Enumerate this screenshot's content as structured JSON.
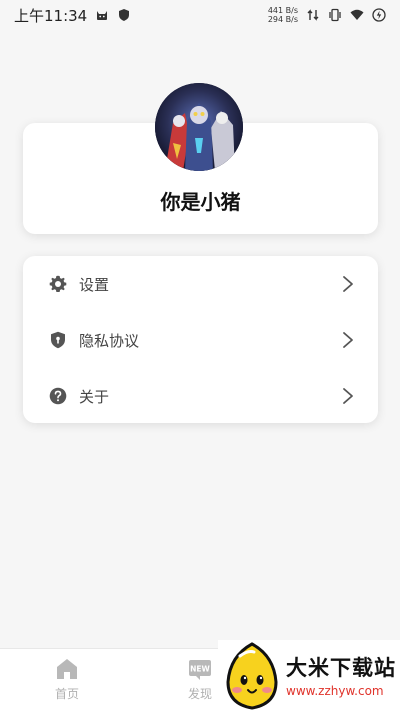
{
  "status_bar": {
    "time": "上午11:34",
    "net_up": "441 B/s",
    "net_down": "294 B/s",
    "icons": [
      "notification-cat-icon",
      "shield-icon",
      "data-arrows-icon",
      "vibrate-icon",
      "wifi-icon",
      "battery-charging-icon"
    ]
  },
  "profile": {
    "username": "你是小猪",
    "avatar_icon": "avatar-image"
  },
  "menu": {
    "items": [
      {
        "label": "设置",
        "icon": "gear-icon"
      },
      {
        "label": "隐私协议",
        "icon": "shield-icon"
      },
      {
        "label": "关于",
        "icon": "question-icon"
      }
    ]
  },
  "bottom_nav": {
    "items": [
      {
        "label": "首页",
        "icon": "home-icon"
      },
      {
        "label": "发现",
        "icon": "new-badge-icon"
      }
    ]
  },
  "watermark": {
    "title": "大米下载站",
    "url": "www.zzhyw.com"
  },
  "colors": {
    "background": "#f6f6f6",
    "card": "#ffffff",
    "nav_inactive": "#b0b0b0",
    "watermark_url": "#e0332b"
  }
}
